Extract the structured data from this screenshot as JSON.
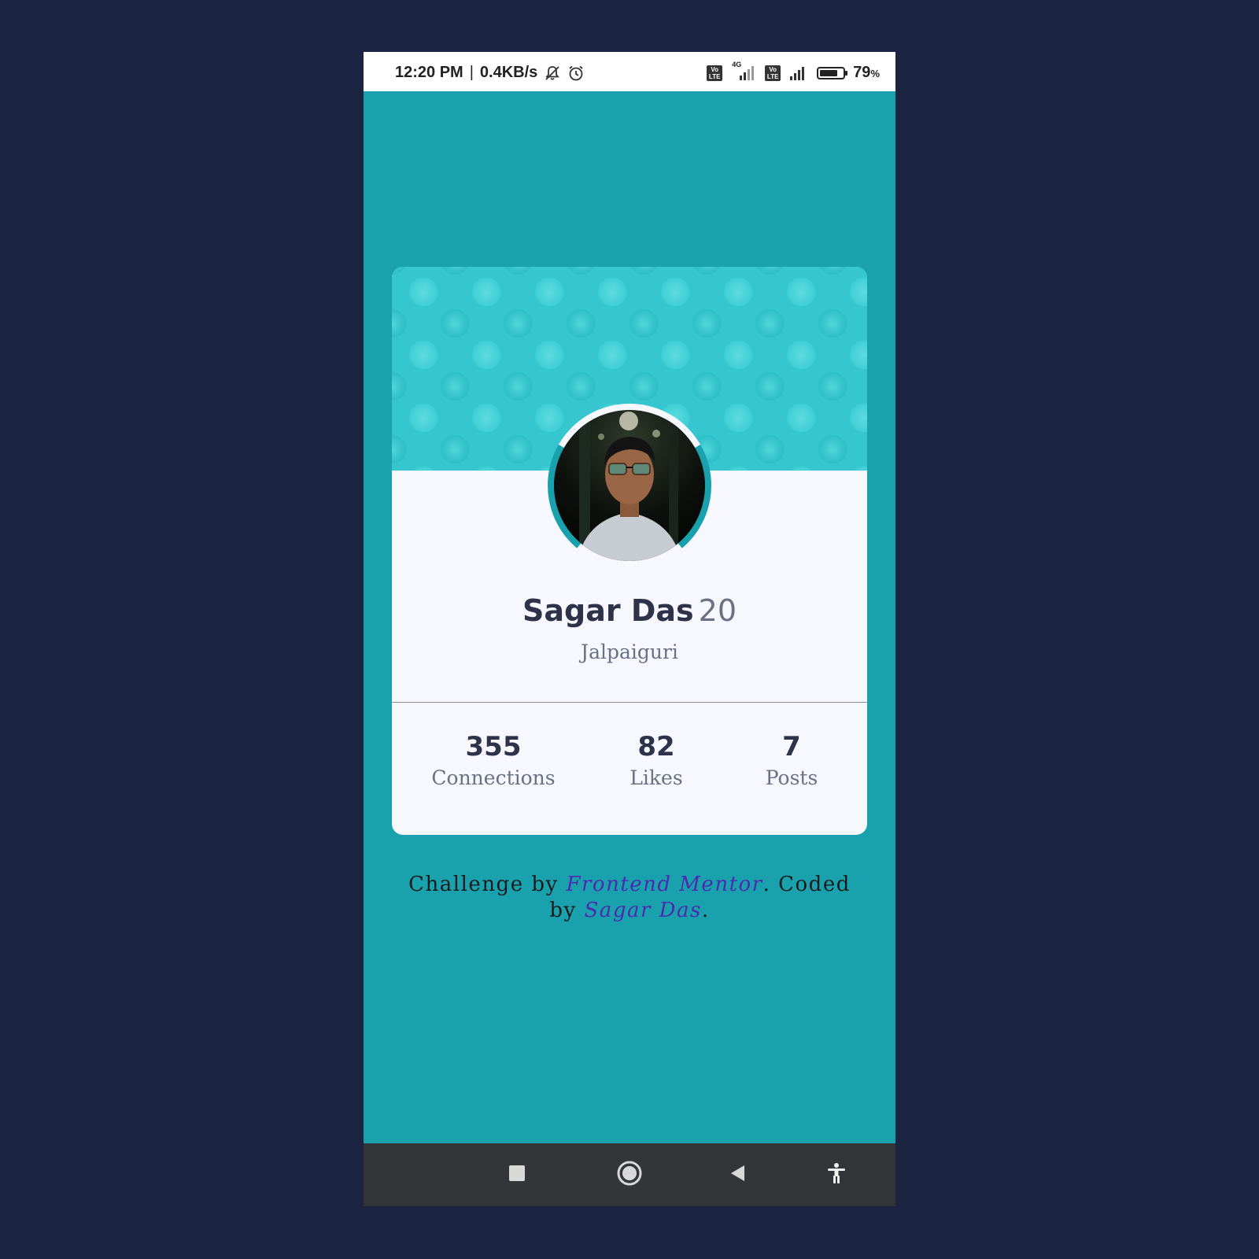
{
  "status_bar": {
    "time": "12:20 PM",
    "separator": "|",
    "network_speed": "0.4KB/s",
    "battery_percent": "79",
    "battery_unit": "%",
    "battery_level": 0.79,
    "network_type": "4G",
    "volte_label_1": "Vo LTE",
    "volte_label_2": "Vo LTE"
  },
  "profile": {
    "name": "Sagar Das",
    "age": "20",
    "location": "Jalpaiguri"
  },
  "stats": [
    {
      "value": "355",
      "label": "Connections"
    },
    {
      "value": "82",
      "label": "Likes"
    },
    {
      "value": "7",
      "label": "Posts"
    }
  ],
  "attribution": {
    "prefix": "Challenge by",
    "link1": "Frontend Mentor",
    "middle": ". Coded by",
    "link2": "Sagar Das",
    "suffix": "."
  },
  "colors": {
    "page_background": "#1b2440",
    "app_background": "#19a2ae",
    "card_background": "#f6f8fd",
    "banner_color": "#35c6cf",
    "text_dark": "#2e3349",
    "text_muted": "#6b7082",
    "link_color": "#4b2bb0"
  },
  "nav": {
    "recent_icon": "square-icon",
    "home_icon": "circle-icon",
    "back_icon": "triangle-back-icon",
    "accessibility_icon": "accessibility-icon"
  }
}
